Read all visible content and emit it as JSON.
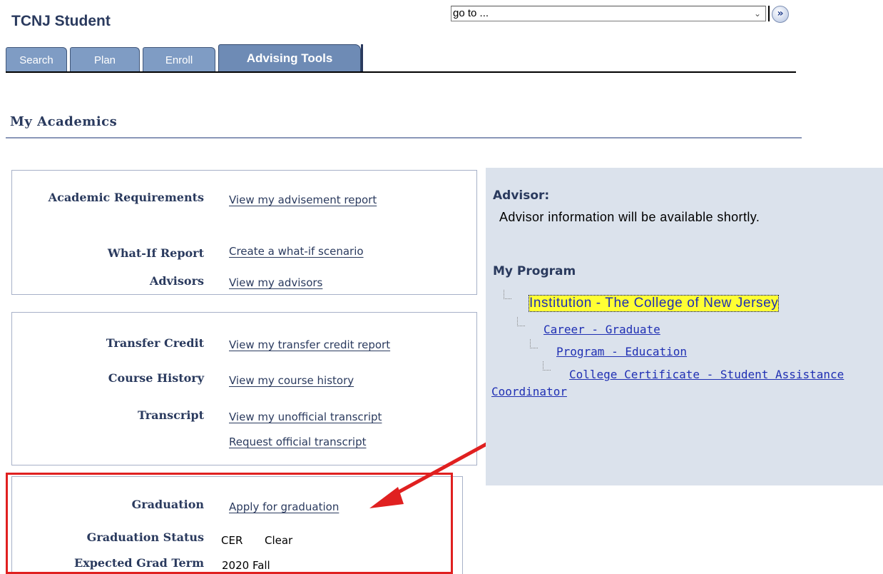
{
  "app": {
    "title": "TCNJ Student"
  },
  "goto": {
    "value": "go to ...",
    "button_icon": "go-arrow-icon"
  },
  "tabs": [
    {
      "label": "Search",
      "active": false
    },
    {
      "label": "Plan",
      "active": false
    },
    {
      "label": "Enroll",
      "active": false
    },
    {
      "label": "Advising Tools",
      "active": true
    }
  ],
  "page": {
    "heading": "My Academics"
  },
  "panel1": {
    "academic_requirements": {
      "label": "Academic Requirements",
      "link": "View my advisement report"
    },
    "what_if": {
      "label": "What-If Report",
      "link": "Create a what-if scenario"
    },
    "advisors": {
      "label": "Advisors",
      "link": "View my advisors"
    }
  },
  "panel2": {
    "transfer_credit": {
      "label": "Transfer Credit",
      "link": "View my transfer credit report"
    },
    "course_history": {
      "label": "Course History",
      "link": "View my course history"
    },
    "transcript": {
      "label": "Transcript",
      "link": "View my unofficial transcript",
      "link2": "Request official transcript"
    }
  },
  "panel3": {
    "graduation": {
      "label": "Graduation",
      "link": "Apply for graduation"
    },
    "graduation_status": {
      "label": "Graduation Status",
      "code": "CER",
      "value": "Clear"
    },
    "expected_term": {
      "label": "Expected Grad Term",
      "value": "2020 Fall"
    }
  },
  "advisor": {
    "heading": "Advisor:",
    "text": "Advisor information will be available shortly."
  },
  "program": {
    "heading": "My Program",
    "institution": "Institution - The College of New Jersey",
    "career": "Career - Graduate",
    "program": "Program - Education",
    "certificate": "College Certificate - Student Assistance",
    "certificate_cont": "Coordinator"
  },
  "colors": {
    "annotation": "#e02020",
    "highlight": "#ffff33",
    "side_panel": "#dbe2ec",
    "tab": "#7f9cc4"
  }
}
